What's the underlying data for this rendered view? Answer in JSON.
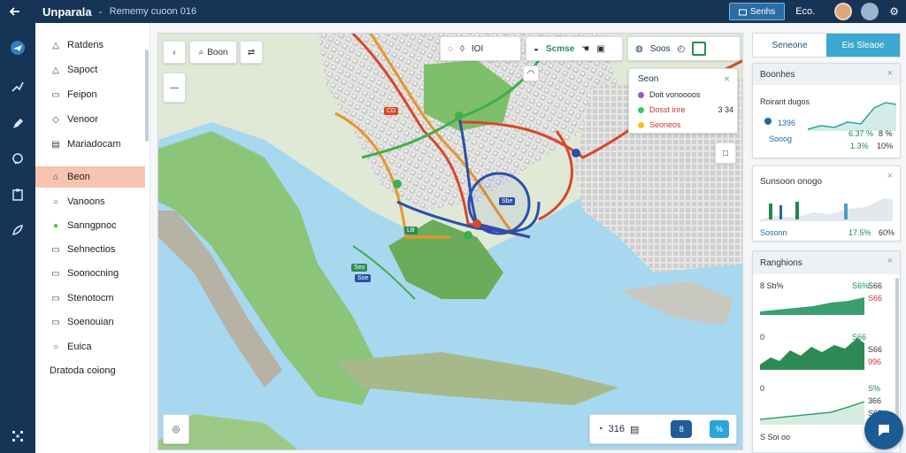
{
  "header": {
    "back_icon": "back-arrow-icon",
    "title": "Unparala",
    "separator": "-",
    "subtitle": "Rememy cuoon 016",
    "primary_button": "Senhs",
    "user_label": "Eco.",
    "settings_icon": "gear-icon"
  },
  "rail": {
    "items": [
      "plane-icon",
      "route-icon",
      "pen-icon",
      "chat-icon",
      "clipboard-icon",
      "rocket-icon",
      "grid-icon"
    ]
  },
  "sidebar": {
    "items": [
      {
        "label": "Ratdens",
        "icon": "triangle-icon"
      },
      {
        "label": "Sapoct",
        "icon": "triangle-icon"
      },
      {
        "label": "Feipon",
        "icon": "doc-icon"
      },
      {
        "label": "Venoor",
        "icon": "tag-icon"
      },
      {
        "label": "Mariadocam",
        "icon": "list-icon"
      },
      {
        "label": "Beon",
        "icon": "house-icon"
      },
      {
        "label": "Vanoons",
        "icon": "pin-icon"
      },
      {
        "label": "Sanngpnoc",
        "icon": "leaf-icon"
      },
      {
        "label": "Sehnectios",
        "icon": "doc-icon"
      },
      {
        "label": "Soonocning",
        "icon": "doc-icon"
      },
      {
        "label": "Stenotocm",
        "icon": "chat-icon"
      },
      {
        "label": "Soenouian",
        "icon": "doc-icon"
      },
      {
        "label": "Euica",
        "icon": "circle-icon"
      },
      {
        "label": "Dratoda coiong",
        "icon": ""
      }
    ],
    "active_index": 5
  },
  "map": {
    "search_label": "Boon",
    "toolbar_left": [
      "IOI"
    ],
    "toolbar_right": [
      "Scmse",
      "Soos"
    ],
    "legend": {
      "title": "Seon",
      "rows": [
        {
          "label": "Doit vonoooos",
          "value": "",
          "color": "#9b59b6"
        },
        {
          "label": "Dosst inre",
          "value": "3 34",
          "color": "#2ecc71"
        },
        {
          "label": "Seoneos",
          "value": "",
          "color": "#f1c40f"
        }
      ]
    },
    "markers": [
      "CD",
      "LB",
      "Sbe",
      "Seo",
      "Soe"
    ],
    "bottom": {
      "value": "316",
      "btn_a": "8",
      "btn_b": "%"
    }
  },
  "right_panel": {
    "tabs": [
      "Seneone",
      "Eis Sleaoe"
    ],
    "card1": {
      "title": "Boonhes",
      "subtitle": "Roirant dugos",
      "value": "1396",
      "footer_left": "Sooog",
      "stat1": "6.37 %",
      "stat2": "1.3%",
      "stat1b": "8 %",
      "stat2b": "10%"
    },
    "card2": {
      "title": "Sunsoon onogo",
      "footer_left": "Sosonn",
      "stat": "17.5%",
      "stat_b": "60%"
    },
    "card3": {
      "title": "Ranghions",
      "rows": [
        {
          "left": "8 Sb%",
          "right_g": "S6%",
          "right_r": "S66",
          "right_b": "S66"
        },
        {
          "left": "0",
          "right_g": "S66",
          "right_r": "S66",
          "right_b": "996"
        },
        {
          "left": "0",
          "right_g": "S%",
          "right_r": "366",
          "right_b": "S69"
        }
      ],
      "footer": "S Soi oo"
    }
  }
}
